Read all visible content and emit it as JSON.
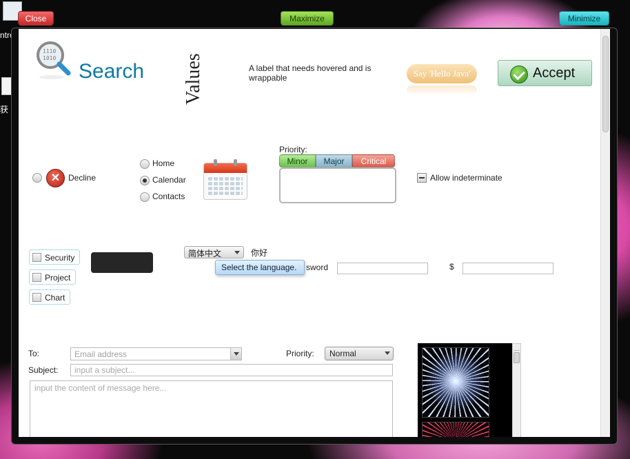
{
  "desktop": {
    "partial_label_1": "ntro",
    "partial_label_2": "获 P"
  },
  "titlebar": {
    "close_label": "Close",
    "maximize_label": "Maximize",
    "minimize_label": "Minimize"
  },
  "row1": {
    "search_label": "Search",
    "values_label": "Values",
    "hover_label": "A label that needs hovered and is wrappable",
    "hello_button": "Say 'Hello Java'",
    "accept_button": "Accept"
  },
  "row2": {
    "decline_label": "Decline",
    "nav_radios": [
      {
        "label": "Home",
        "selected": false
      },
      {
        "label": "Calendar",
        "selected": true
      },
      {
        "label": "Contacts",
        "selected": false
      }
    ],
    "priority_label": "Priority:",
    "priority_segments": [
      "Minor",
      "Major",
      "Critical"
    ],
    "allow_indeterminate": "Allow indeterminate",
    "calendar_icon": "calendar-icon"
  },
  "row3": {
    "checkboxes": [
      "Security",
      "Project",
      "Chart"
    ],
    "language_value": "简体中文",
    "hello_chinese": "你好",
    "tooltip": "Select the language.",
    "password_label_partial": "sword",
    "currency_symbol": "$"
  },
  "email": {
    "to_label": "To:",
    "to_placeholder": "Email address",
    "priority_label": "Priority:",
    "priority_value": "Normal",
    "subject_label": "Subject:",
    "subject_placeholder": "input a subject...",
    "message_placeholder": "input the content of message here..."
  },
  "colors": {
    "search_title": "#0e7aa0",
    "minor": "#6cc050",
    "major": "#86b5ca",
    "critical": "#dd5a4a"
  }
}
